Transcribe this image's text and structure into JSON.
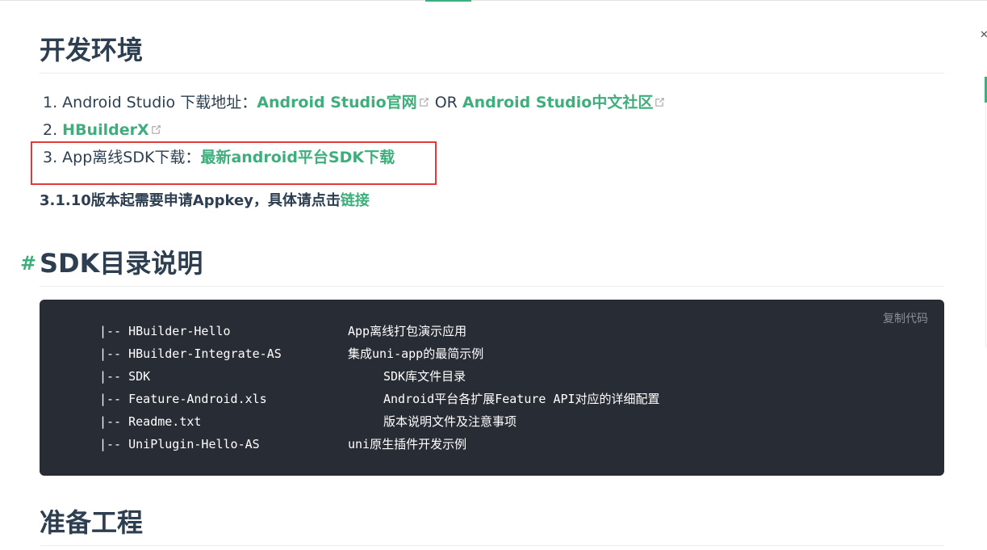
{
  "sections": {
    "dev_env": {
      "title": "开发环境"
    },
    "sdk_dir": {
      "anchor": "#",
      "title": "SDK目录说明"
    },
    "prepare": {
      "title": "准备工程"
    }
  },
  "env_list": [
    {
      "prefix": "1. Android Studio 下载地址：",
      "link1": "Android Studio官网",
      "or": "OR",
      "link2": "Android Studio中文社区"
    },
    {
      "prefix": "2. ",
      "link1": "HBuilderX"
    },
    {
      "prefix": "3. App离线SDK下载：",
      "link1": "最新android平台SDK下载"
    }
  ],
  "note": {
    "text": "3.1.10版本起需要申请Appkey，具体请点击",
    "link": "链接"
  },
  "code": {
    "copy_label": "复制代码",
    "lines": [
      {
        "left": "|-- HBuilder-Hello",
        "right": "App离线打包演示应用"
      },
      {
        "left": "|-- HBuilder-Integrate-AS",
        "right": "集成uni-app的最简示例"
      },
      {
        "left": "|-- SDK",
        "right": "SDK库文件目录"
      },
      {
        "left": "|-- Feature-Android.xls",
        "right": "Android平台各扩展Feature API对应的详细配置"
      },
      {
        "left": "|-- Readme.txt",
        "right": "版本说明文件及注意事项"
      },
      {
        "left": "|-- UniPlugin-Hello-AS",
        "right": "uni原生插件开发示例"
      }
    ]
  },
  "accent_color": "#3eaf7c",
  "highlight_color": "#e03a3a",
  "icons": [
    "external-link-icon",
    "close-icon"
  ]
}
